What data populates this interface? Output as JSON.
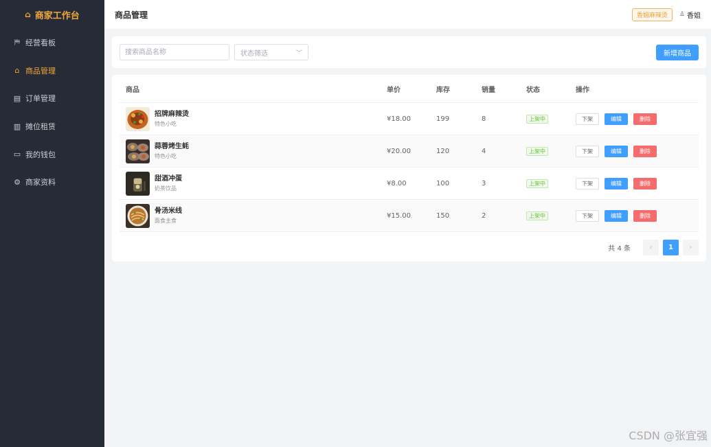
{
  "sidebar": {
    "brand": "商家工作台",
    "brand_icon": "bag-icon",
    "items": [
      {
        "label": "经营看板",
        "icon": "dashboard-icon",
        "glyph": "⛿",
        "active": false
      },
      {
        "label": "商品管理",
        "icon": "bag-icon",
        "glyph": "⌂",
        "active": true
      },
      {
        "label": "订单管理",
        "icon": "clipboard-icon",
        "glyph": "▤",
        "active": false
      },
      {
        "label": "摊位租赁",
        "icon": "building-icon",
        "glyph": "▥",
        "active": false
      },
      {
        "label": "我的钱包",
        "icon": "folder-icon",
        "glyph": "▭",
        "active": false
      },
      {
        "label": "商家资料",
        "icon": "gear-icon",
        "glyph": "⚙",
        "active": false
      }
    ]
  },
  "header": {
    "title": "商品管理",
    "shop_tag": "香姐麻辣烫",
    "user_name": "香姐",
    "user_icon": "user-icon"
  },
  "filters": {
    "search_placeholder": "搜索商品名称",
    "search_value": "",
    "status_placeholder": "状态筛选",
    "add_button": "新增商品"
  },
  "table": {
    "columns": [
      "商品",
      "单价",
      "库存",
      "销量",
      "状态",
      "操作"
    ],
    "rows": [
      {
        "name": "招牌麻辣烫",
        "category": "特色小吃",
        "price": "¥18.00",
        "stock": "199",
        "sales": "8",
        "status": "上架中"
      },
      {
        "name": "蒜蓉烤生蚝",
        "category": "特色小吃",
        "price": "¥20.00",
        "stock": "120",
        "sales": "4",
        "status": "上架中"
      },
      {
        "name": "甜酒冲蛋",
        "category": "奶茶饮品",
        "price": "¥8.00",
        "stock": "100",
        "sales": "3",
        "status": "上架中"
      },
      {
        "name": "骨汤米线",
        "category": "面食主食",
        "price": "¥15.00",
        "stock": "150",
        "sales": "2",
        "status": "上架中"
      }
    ],
    "actions": {
      "off": "下架",
      "edit": "编辑",
      "delete": "删除"
    }
  },
  "pagination": {
    "total_text": "共 4 条",
    "current_page": "1",
    "prev": "‹",
    "next": "›"
  },
  "watermark": "CSDN @张宜强",
  "colors": {
    "sidebar_bg": "#262b36",
    "accent": "#f0a73c",
    "primary": "#409eff",
    "danger": "#f56c6c",
    "success": "#67c23a"
  }
}
